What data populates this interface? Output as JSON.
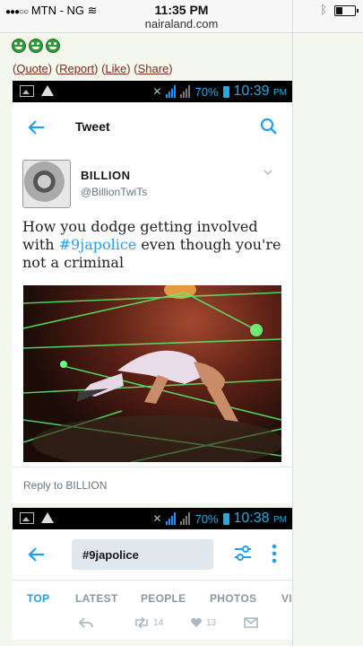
{
  "ios_status": {
    "carrier": "MTN - NG",
    "time": "11:35 PM",
    "url": "nairaland.com"
  },
  "post_actions": {
    "quote": "Quote",
    "report": "Report",
    "like": "Like",
    "share": "Share"
  },
  "screenshot_1": {
    "status": {
      "battery": "70%",
      "time": "10:39",
      "ampm": "PM"
    },
    "title": "Tweet",
    "tweet": {
      "name": "BILLION",
      "handle": "@BillionTwiTs",
      "text_before": "How you dodge getting involved with ",
      "hashtag": "#9japolice",
      "text_after": " even though you're not a criminal"
    },
    "reply": "Reply to BILLION"
  },
  "screenshot_2": {
    "status": {
      "battery": "70%",
      "time": "10:38",
      "ampm": "PM"
    },
    "search_query": "#9japolice",
    "tabs": [
      "TOP",
      "LATEST",
      "PEOPLE",
      "PHOTOS",
      "VI"
    ],
    "retweets": "14",
    "likes": "13"
  },
  "colors": {
    "twitter_blue": "#1da1f2",
    "android_accent": "#29a9e0",
    "link": "#7a2d1c"
  }
}
